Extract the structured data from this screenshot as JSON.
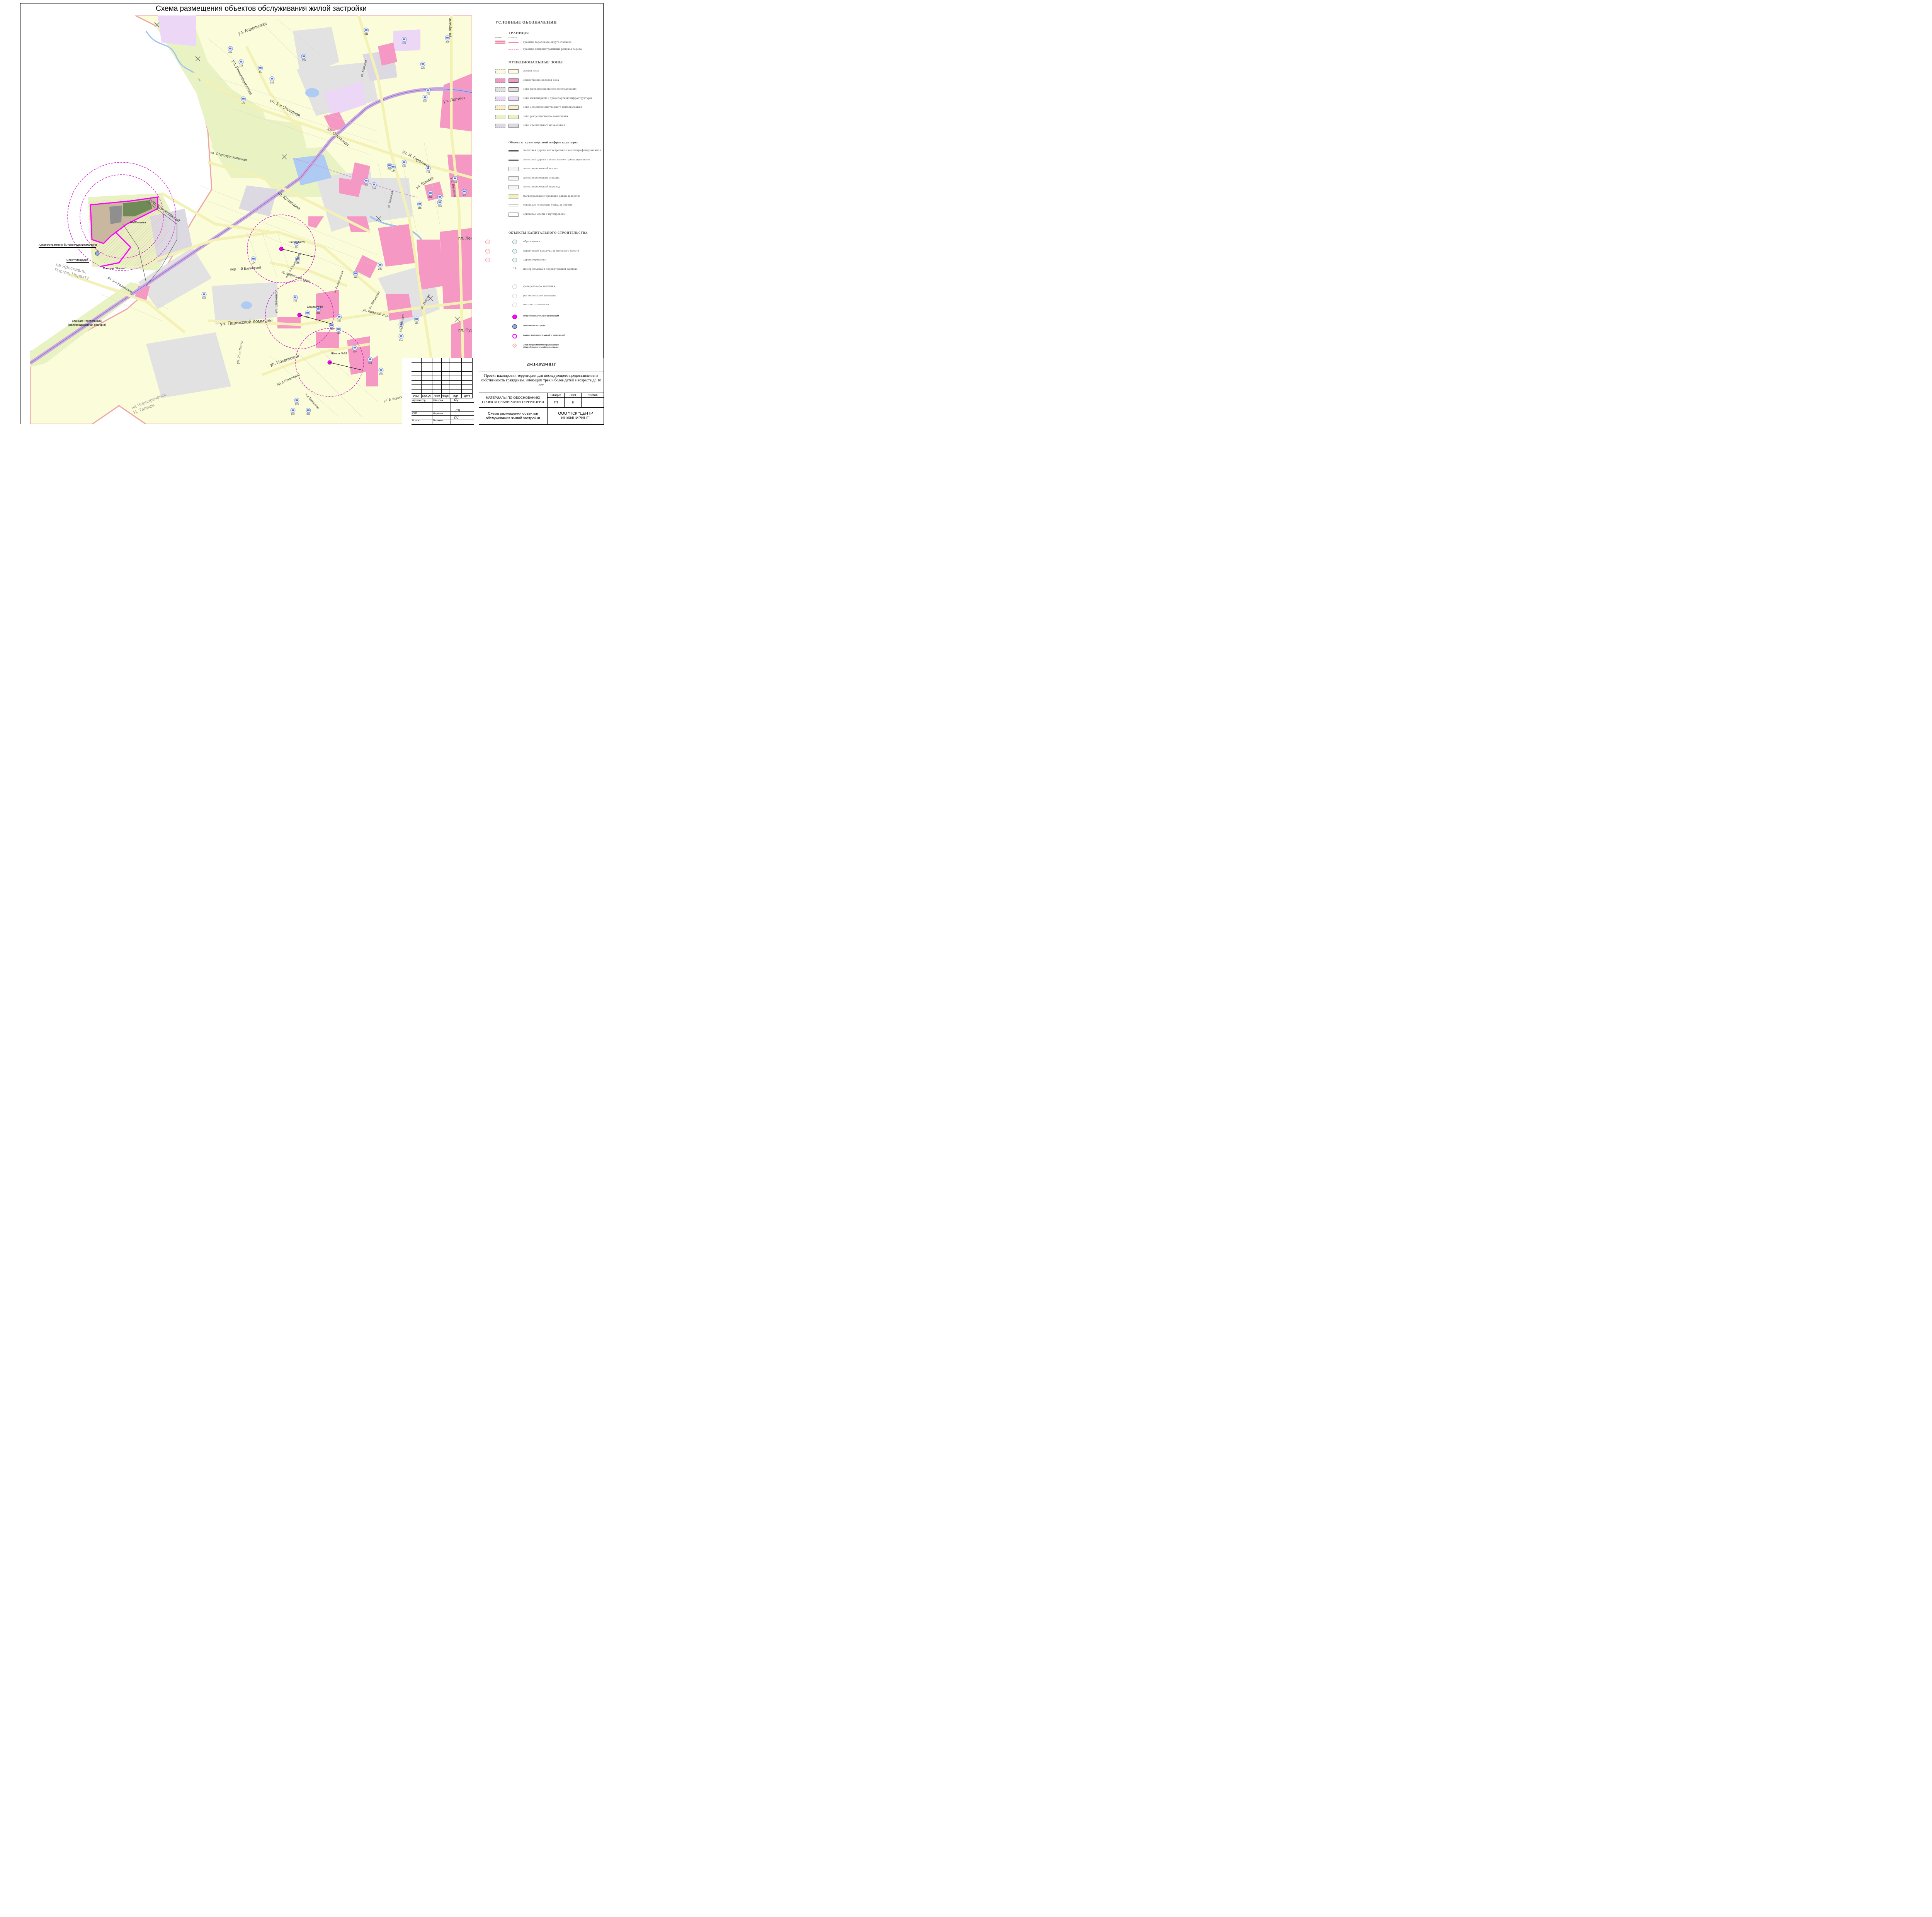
{
  "title": "Схема размещения объектов обслуживания жилой застройки",
  "streets": [
    "ул. Апрельская",
    "ул. Революционная",
    "ул. 1-я Отрадная",
    "ул. Смольная",
    "ул. Я. Гарелина",
    "ул. Фрунзе",
    "ул. Лютина",
    "ул. Ермака",
    "ул. Ленина",
    "ул. Кузнецова",
    "пер. Курьяновский",
    "ул. Старокурьяновская",
    "ул. Парижской Коммуны",
    "ул. Поселковая",
    "ул. 1-я Балинская",
    "пер. 1-й Балинский",
    "пр-д Красной зари",
    "ул. Красной зари",
    "ул. 25-я Линия",
    "пр-д Бакинский",
    "3-я Бухшина",
    "ул. Шевченко",
    "ул. Жиделева",
    "пл. Ленина",
    "пл. Пушкина",
    "ул. Майская",
    "ул. Танкиста",
    "ул. Жарова",
    "пер. 3-й Балинский",
    "ул. Б. Воробьевская",
    "ул. Рыбаковская",
    "ул. Маршала"
  ],
  "places": {
    "yaroslavl": [
      "на Ярославль,",
      "Ростов, Нерехту"
    ],
    "chernorechensk": [
      "на Чернореченск,",
      "Н. Талицы"
    ]
  },
  "callouts": {
    "admin_building": "Административно-бытовое здание/магазин",
    "sports_ground": "Спортплощадка",
    "magnit": "Магазин \"Магнит\"",
    "fap": "ФАП/аптека",
    "station": [
      "Станция Текстильный",
      "(железнодорожная станция)"
    ],
    "schools": [
      "Школа №29",
      "Школа №35",
      "Школа №24"
    ]
  },
  "legend": {
    "title": "УСЛОВНЫЕ ОБОЗНАЧЕНИЯ",
    "boundaries_header": "ГРАНИЦЫ",
    "col_labels": [
      "проект",
      "существ."
    ],
    "boundaries": [
      "граница городского округа Иваново",
      "граница административных районов города"
    ],
    "zones_header": "ФУНКЦИОНАЛЬНЫЕ ЗОНЫ",
    "zones": [
      {
        "label": "жилая зона",
        "color": "#fbfcd9"
      },
      {
        "label": "общественно-деловая зона",
        "color": "#f598c3"
      },
      {
        "label": "зона производственного использования",
        "color": "#e2e2e2"
      },
      {
        "label": "зона инженерной и транспортной инфраструктуры",
        "color": "#ecd8f6"
      },
      {
        "label": "зона сельскохозяйственного использования",
        "color": "#fbf0c4"
      },
      {
        "label": "зона рекреационного назначения",
        "color": "#e9f2c3"
      },
      {
        "label": "зона специального назначения",
        "color": "#dcd9e2"
      }
    ],
    "transport_header": "Объекты транспортной инфраструктуры",
    "transport": [
      "железная дорога магистральная неэлектрифицированная",
      "железная дорога прочая неэлектрифицированная",
      "железнодорожный вокзал",
      "железнодорожная станция",
      "железнодорожный переезд",
      "магистральные городские улицы и дороги",
      "основные городские улицы и дороги",
      "основные мосты и путепроводы"
    ],
    "capital_header": "ОБЪЕКТЫ КАПИТАЛЬНОГО СТРОИТЕЛЬСТВА",
    "capital": [
      "образования",
      "физической культуры и массового спорта",
      "здравоохранения",
      "номер объекта в пояснительной записке"
    ],
    "capital_number_sample": "14",
    "significance": [
      "федерального значения",
      "регионального значения",
      "местного значения"
    ],
    "extra": [
      {
        "label": "общеобразовательные организации",
        "color": "#ff00ff"
      },
      {
        "label": "спортивные площадки",
        "color": "#8faaf0"
      },
      {
        "label": "радиус доступности зданий и сооружений",
        "color": "#ff00ff"
      },
      {
        "label": "Зона предполагаемого размещения общеобразовательной организации",
        "color": "#f7b3b3"
      }
    ]
  },
  "title_block": {
    "code": "26-11-18/28-ППТ",
    "project": "Проект планировки территории для последующего предоставления в собственность гражданам, имеющим трех и более детей в возрасте до 18 лет",
    "headers": [
      "Изм.",
      "Кол.уч.",
      "Лист",
      "№Док.",
      "Подп.",
      "Дата"
    ],
    "section": "МАТЕРИАЛЫ ПО ОБОСНОВАНИЮ ПРОЕКТА ПЛАНИРОВКИ ТЕРРИТОРИИ",
    "sheet_headers": [
      "Стадия",
      "Лист",
      "Листов"
    ],
    "stage": "ГП",
    "sheet": "9",
    "sheets_total": "",
    "drawing_name": "Схема размещения объектов обслуживания жилой застройки",
    "company": "ООО \"ПСК \"ЦЕНТР ИНЖИНИРИНГ\"",
    "people": [
      {
        "role": "Архитектор",
        "name": "Шишова"
      },
      {
        "role": "ГАП",
        "name": "Царахов"
      },
      {
        "role": "Н. конт.",
        "name": "Головин"
      }
    ]
  },
  "building_numbers": [
    "424",
    "311",
    "289",
    "309",
    "118",
    "310",
    "91",
    "188",
    "171",
    "276",
    "111",
    "186",
    "317",
    "131",
    "134",
    "119",
    "294",
    "262",
    "222",
    "389",
    "331",
    "97",
    "328",
    "265",
    "161",
    "104",
    "155",
    "340",
    "240",
    "187",
    "229",
    "331",
    "181",
    "238",
    "385",
    "355",
    "319",
    "199",
    "193",
    "119",
    "182",
    "419",
    "398",
    "381",
    "390"
  ]
}
